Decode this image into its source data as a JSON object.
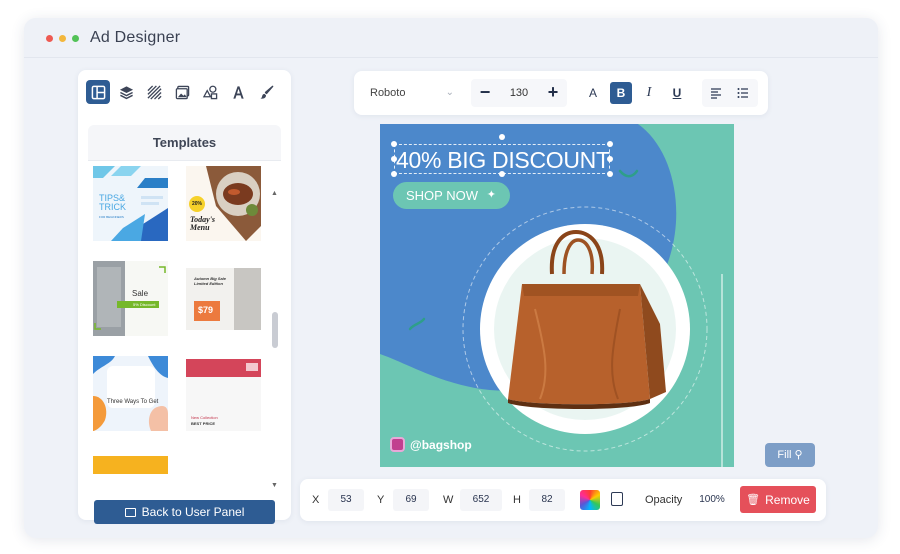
{
  "window": {
    "title": "Ad Designer"
  },
  "left_panel": {
    "tools": [
      {
        "name": "layout-icon",
        "active": true
      },
      {
        "name": "layers-icon",
        "active": false
      },
      {
        "name": "pattern-icon",
        "active": false
      },
      {
        "name": "image-icon",
        "active": false
      },
      {
        "name": "shapes-icon",
        "active": false
      },
      {
        "name": "text-icon",
        "active": false
      },
      {
        "name": "brush-icon",
        "active": false
      }
    ],
    "templates_title": "Templates",
    "templates": [
      {
        "name": "template-tips-trick",
        "text_main": "TIPS& TRICK",
        "text_sub": "FOR BEGINNERS"
      },
      {
        "name": "template-todays-menu",
        "badge": "20%",
        "text_main": "Today's Menu"
      },
      {
        "name": "template-sale",
        "text_main": "Sale",
        "text_sub": "5% Discount"
      },
      {
        "name": "template-autumn-sale",
        "text_main": "Autumn Big Sale Limited Edition",
        "price": "$79"
      },
      {
        "name": "template-three-ways",
        "text_main": "Three Ways To Get"
      },
      {
        "name": "template-new-collection",
        "text_main": "New Collection",
        "text_sub": "BEST PRICE"
      },
      {
        "name": "template-orange",
        "text_main": ""
      },
      {
        "name": "template-blank",
        "text_main": ""
      }
    ],
    "back_button": "Back to User Panel"
  },
  "toolbar": {
    "font": "Roboto",
    "font_size": "130",
    "minus": "−",
    "plus": "+",
    "case_label": "A",
    "bold_label": "B",
    "italic_label": "I",
    "underline_label": "U"
  },
  "canvas": {
    "headline": "40% BIG DISCOUNT",
    "cta": "SHOP NOW",
    "handle": "@bagshop",
    "colors": {
      "blue": "#4c88cb",
      "teal": "#6cc6b3",
      "bag": "#b7612c"
    }
  },
  "fill_button": "Fill",
  "bottom": {
    "x_label": "X",
    "x": "53",
    "y_label": "Y",
    "y": "69",
    "w_label": "W",
    "w": "652",
    "h_label": "H",
    "h": "82",
    "opacity_label": "Opacity",
    "opacity": "100%",
    "remove_button": "Remove"
  },
  "colors": {
    "accent": "#2e5c93",
    "danger": "#e5505a",
    "fill_btn": "#7d9ec7"
  }
}
